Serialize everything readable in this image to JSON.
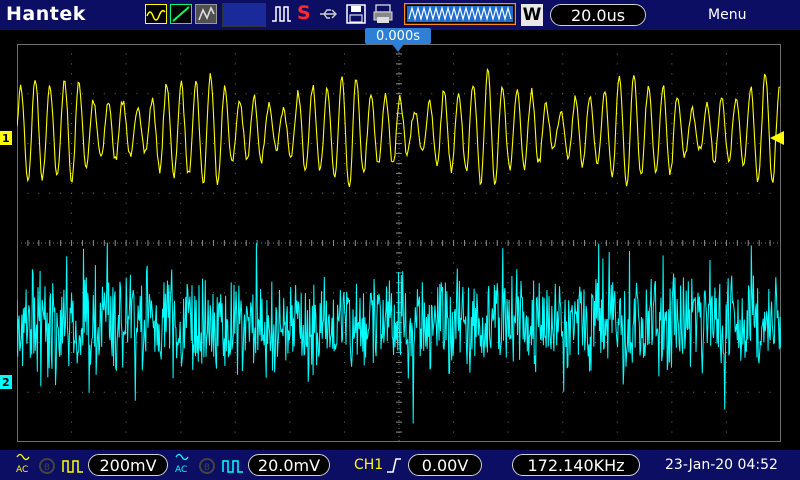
{
  "brand": "Hantek",
  "toolbar": {
    "timebase_mode_label": "W",
    "timebase_value": "20.0us",
    "menu_label": "Menu",
    "run_state": "S"
  },
  "trigger_time": "0.000s",
  "channels": {
    "ch1": {
      "marker": "1",
      "color": "#ffff00",
      "coupling": "AC",
      "scale": "200mV"
    },
    "ch2": {
      "marker": "2",
      "color": "#00ffff",
      "coupling": "AC",
      "scale": "20.0mV"
    }
  },
  "trigger": {
    "source": "CH1",
    "level": "0.00V"
  },
  "frequency": "172.140KHz",
  "datetime": "23-Jan-20 04:52",
  "colors": {
    "bar_bg": "#0b0e63",
    "ch1": "#ffff00",
    "ch2": "#00ffff",
    "grid": "#6e6e6e",
    "trigger_marker": "#2e7fd6",
    "run_stop": "#ff2a2a",
    "accent_orange": "#ff8c1a"
  }
}
